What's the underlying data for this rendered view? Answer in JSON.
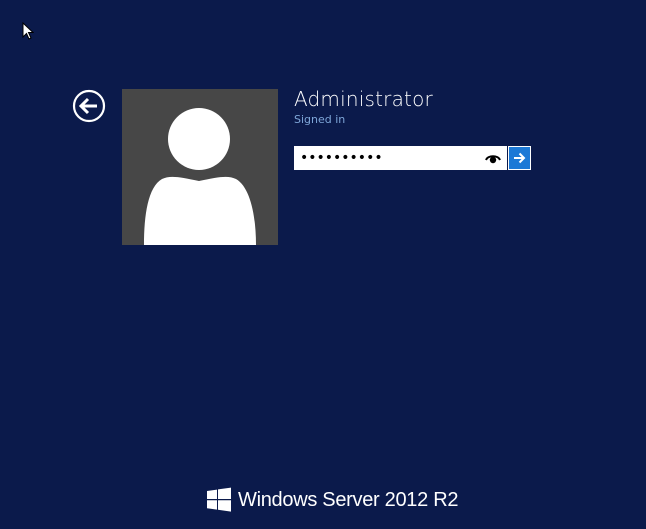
{
  "login": {
    "user_name": "Administrator",
    "status": "Signed in",
    "password_value": "••••••••••",
    "back_icon": "back-arrow-icon",
    "reveal_icon": "eye-icon",
    "submit_icon": "arrow-right-icon"
  },
  "branding": {
    "text": "Windows Server 2012 R2",
    "logo_icon": "windows-logo-icon"
  },
  "colors": {
    "background": "#0b1a4b",
    "avatar_bg": "#474747",
    "accent": "#1c79d6",
    "status_text": "#7ea6d8"
  }
}
